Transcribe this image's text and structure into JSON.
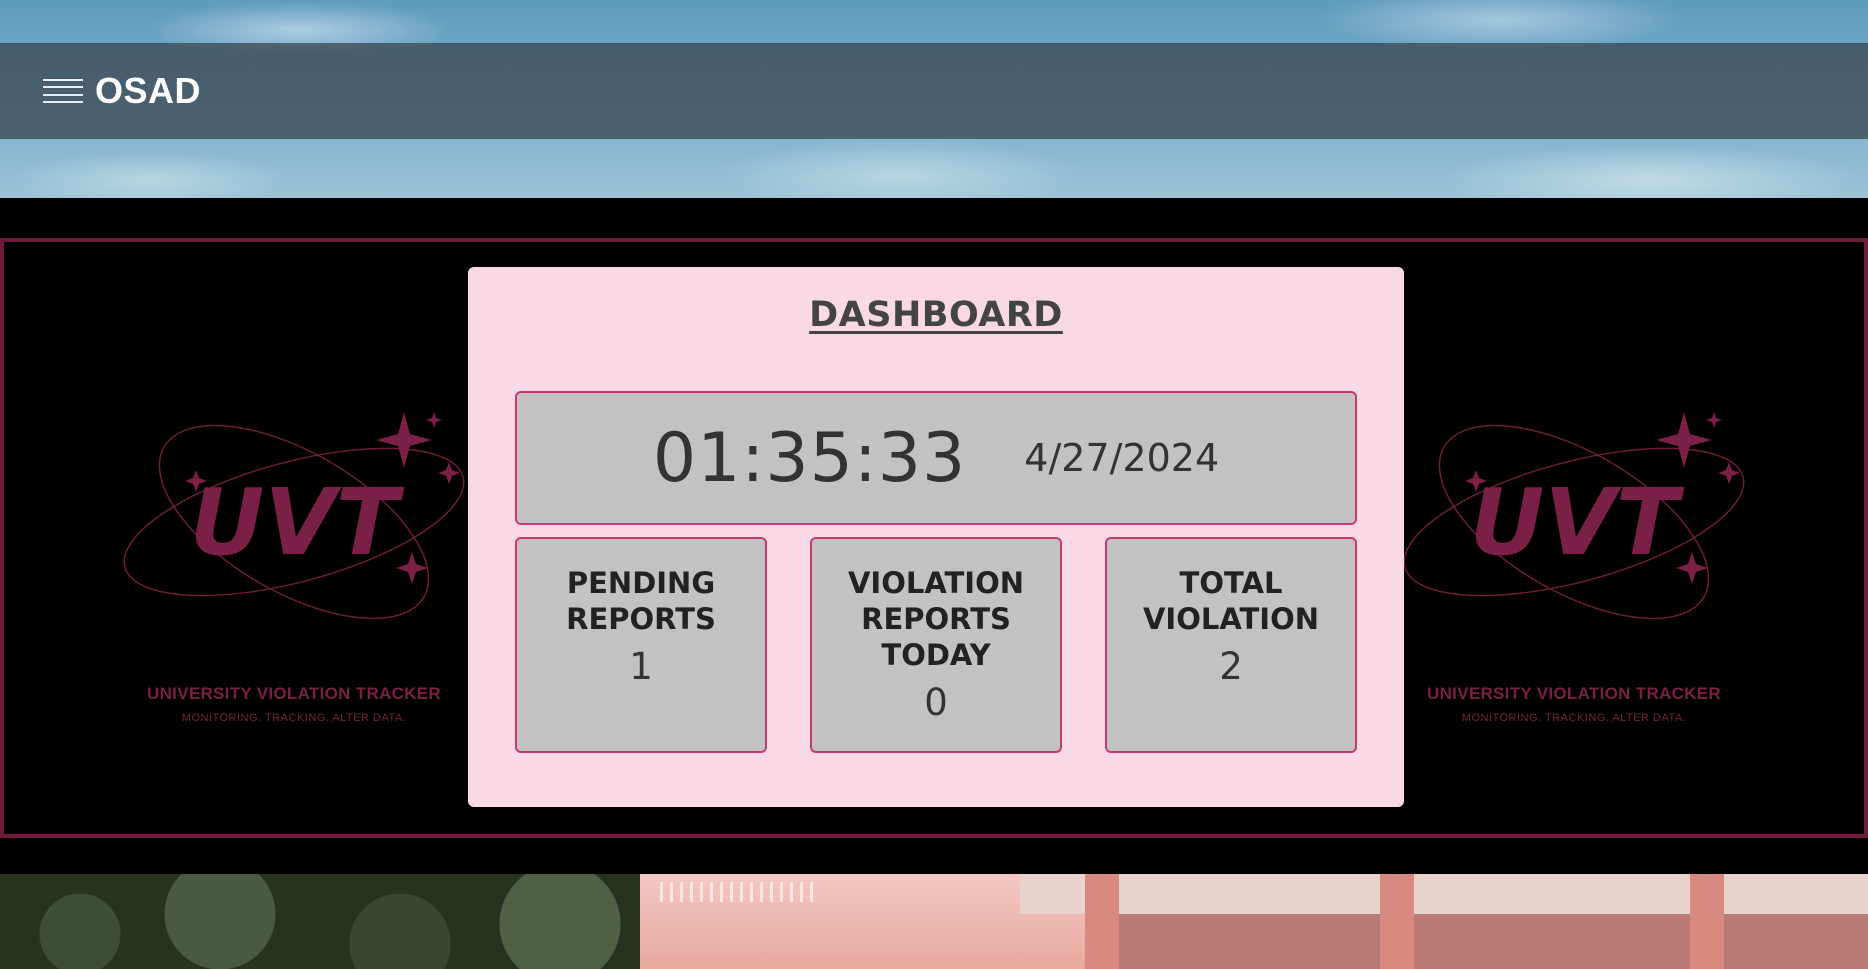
{
  "header": {
    "brand": "OSAD",
    "menu_icon": "hamburger-menu-icon"
  },
  "banner": {
    "logo_text": "UVT",
    "title": "UNIVERSITY VIOLATION TRACKER",
    "tagline": "MONITORING.  TRACKING.  ALTER DATA.",
    "accent_color": "#7a1f45"
  },
  "dashboard": {
    "title": "DASHBOARD",
    "time": "01:35:33",
    "date": "4/27/2024",
    "stats": [
      {
        "label": "PENDING REPORTS",
        "value": "1"
      },
      {
        "label": "VIOLATION REPORTS TODAY",
        "value": "0"
      },
      {
        "label": "TOTAL VIOLATION",
        "value": "2"
      }
    ],
    "card_color": "#f9d9e6",
    "box_color": "#c2c2c2",
    "border_color": "#c7386f"
  }
}
